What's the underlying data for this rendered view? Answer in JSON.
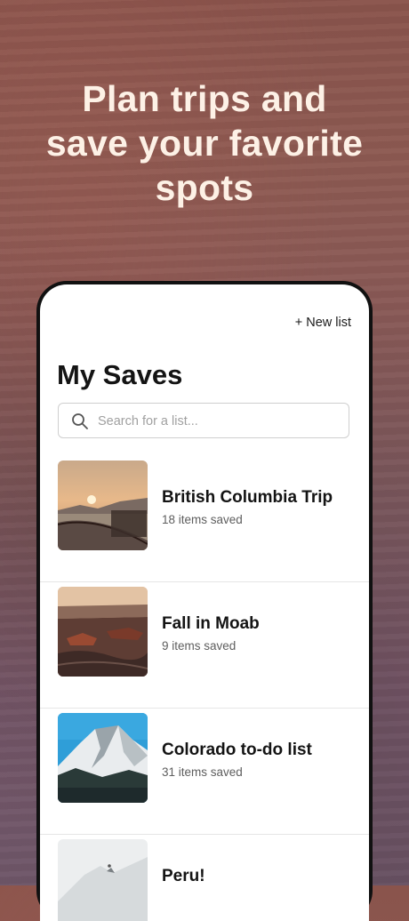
{
  "headline": {
    "line1": "Plan trips and",
    "line2": "save your favorite",
    "line3": "spots"
  },
  "screen": {
    "new_list_label": "+ New list",
    "title": "My Saves",
    "search": {
      "placeholder": "Search for a list...",
      "value": ""
    },
    "lists": [
      {
        "title": "British Columbia Trip",
        "count": "18 items saved",
        "image": "sunset-lake"
      },
      {
        "title": "Fall in Moab",
        "count": "9 items saved",
        "image": "canyon"
      },
      {
        "title": "Colorado to-do list",
        "count": "31 items saved",
        "image": "snowy-mountain"
      },
      {
        "title": "Peru!",
        "count": "",
        "image": "misty-peak"
      }
    ]
  },
  "colors": {
    "background": "#8a5a57",
    "headline_text": "#fdf1e6",
    "phone_frame": "#111111",
    "screen": "#ffffff"
  }
}
